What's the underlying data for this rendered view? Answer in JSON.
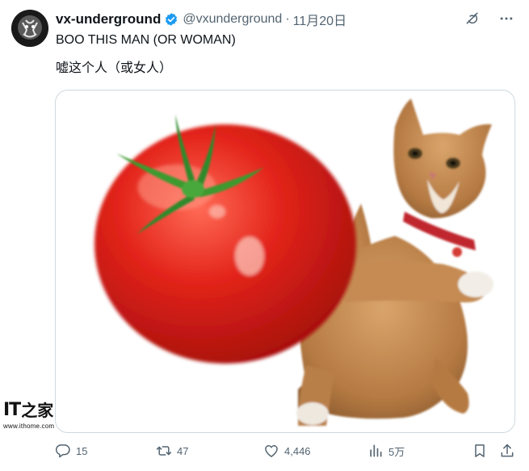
{
  "tweet": {
    "display_name": "vx-underground",
    "handle": "@vxunderground",
    "separator": "·",
    "date": "11月20日",
    "text_en": "BOO THIS MAN (OR WOMAN)",
    "text_cn": "嘘这个人（或女人）"
  },
  "media": {
    "subject": "cat-throwing-tomato"
  },
  "watermark": {
    "logo_latin": "IT",
    "logo_cjk": "之家",
    "url": "www.ithome.com"
  },
  "actions": {
    "replies": "15",
    "retweets": "47",
    "likes": "4,446",
    "views": "5万"
  },
  "icons": {
    "verified": "verified-badge-icon",
    "grok": "grok-icon",
    "more": "more-icon",
    "reply": "reply-icon",
    "retweet": "retweet-icon",
    "like": "heart-icon",
    "views": "views-icon",
    "bookmark": "bookmark-icon",
    "share": "share-icon"
  },
  "colors": {
    "verified": "#1d9bf0",
    "secondary_text": "#536471",
    "primary_text": "#0f1419",
    "tomato": "#e2231a",
    "cat_fur": "#c98e55"
  }
}
